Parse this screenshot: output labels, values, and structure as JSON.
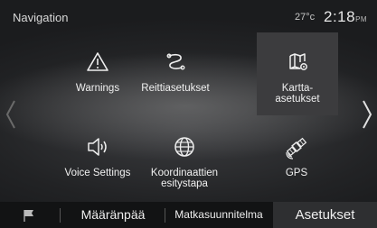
{
  "header": {
    "title": "Navigation",
    "temperature": "27°c",
    "time": "2:18",
    "time_suffix": "PM"
  },
  "menu": {
    "items": [
      {
        "label": "Warnings",
        "icon": "warning-triangle-icon"
      },
      {
        "label": "Reittiasetukset",
        "icon": "route-icon"
      },
      {
        "label": "Kartta-\nasetukset",
        "icon": "map-settings-icon",
        "selected": true
      },
      {
        "label": "Voice Settings",
        "icon": "speaker-icon"
      },
      {
        "label": "Koordinaattien\nesitystapa",
        "icon": "globe-icon"
      },
      {
        "label": "GPS",
        "icon": "satellite-icon"
      }
    ]
  },
  "tabs": {
    "flag_icon": "flag-icon",
    "destination": "Määränpää",
    "route_planner": "Matkasuunnitelma",
    "settings": "Asetukset",
    "active": "settings"
  },
  "colors": {
    "selected_tile": "#3c3c3e",
    "active_tab": "#2e2f31"
  }
}
